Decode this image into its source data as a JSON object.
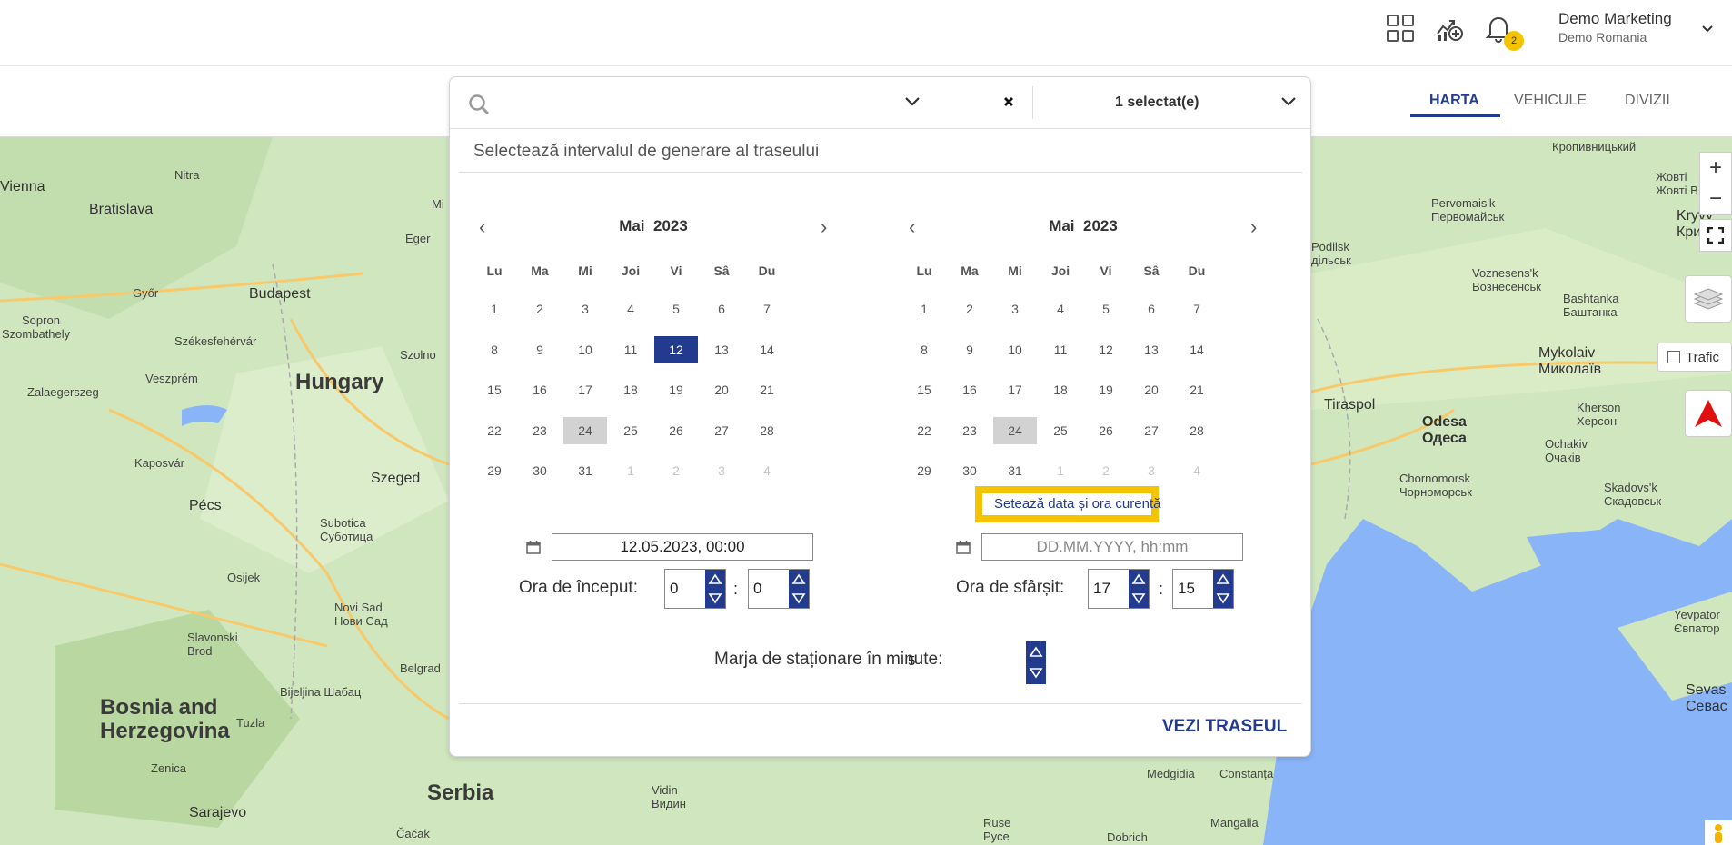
{
  "header": {
    "apps_icon": "grid-icon",
    "stats_icon": "chart-add-icon",
    "bell_icon": "bell-icon",
    "notification_count": "2",
    "user_name": "Demo Marketing",
    "user_org": "Demo Romania"
  },
  "nav": {
    "tabs": [
      "HARTA",
      "VEHICULE",
      "DIVIZII"
    ],
    "active": "HARTA"
  },
  "panel": {
    "search_placeholder": "",
    "selected_label": "1 selectat(e)",
    "title": "Selectează intervalul de generare al traseului",
    "left_calendar": {
      "month": "Mai",
      "year": "2023",
      "selected_day": 12,
      "today": 24
    },
    "right_calendar": {
      "month": "Mai",
      "year": "2023",
      "today": 24
    },
    "weekdays": [
      "Lu",
      "Ma",
      "Mi",
      "Joi",
      "Vi",
      "Sâ",
      "Du"
    ],
    "weeks": [
      [
        "1",
        "2",
        "3",
        "4",
        "5",
        "6",
        "7"
      ],
      [
        "8",
        "9",
        "10",
        "11",
        "12",
        "13",
        "14"
      ],
      [
        "15",
        "16",
        "17",
        "18",
        "19",
        "20",
        "21"
      ],
      [
        "22",
        "23",
        "24",
        "25",
        "26",
        "27",
        "28"
      ],
      [
        "29",
        "30",
        "31",
        "1",
        "2",
        "3",
        "4"
      ]
    ],
    "set_now_button": "Setează data și ora curentă",
    "start_date_value": "12.05.2023, 00:00",
    "end_date_placeholder": "DD.MM.YYYY, hh:mm",
    "start_time_label": "Ora de început:",
    "start_hour": "0",
    "start_minute": "0",
    "end_time_label": "Ora de sfârșit:",
    "end_hour": "17",
    "end_minute": "15",
    "colon": ":",
    "margin_label": "Marja de staționare în minute:",
    "margin_value": "5",
    "submit": "VEZI TRASEUL"
  },
  "map": {
    "traffic_label": "Trafic",
    "zoom_in": "+",
    "zoom_out": "−",
    "labels": {
      "vienna": "Vienna",
      "bratislava": "Bratislava",
      "nitra": "Nitra",
      "gyor": "Győr",
      "budapest": "Budapest",
      "sopron": "Sopron",
      "szombathely": "Szombathely",
      "szekesfehervar": "Székesfehérvár",
      "szolno": "Szolno",
      "hungary": "Hungary",
      "veszprem": "Veszprém",
      "zalaegerszeg": "Zalaegerszeg",
      "kaposvar": "Kaposvár",
      "pecs": "Pécs",
      "szeged": "Szeged",
      "subotica": "Subotica\nСуботица",
      "osijek": "Osijek",
      "novi_sad": "Novi Sad\nНови Сад",
      "slavonski": "Slavonski\nBrod",
      "belgrad": "Belgrad",
      "bijeljina": "Bijeljina Шабац",
      "bosnia": "Bosnia and\nHerzegovina",
      "tuzla": "Tuzla",
      "zenica": "Zenica",
      "serbia": "Serbia",
      "sarajevo": "Sarajevo",
      "cacak": "Čačak",
      "egger": "Eger",
      "vidin": "Vidin\nВидин",
      "ruse": "Ruse\nРусе",
      "dobrich": "Dobrich",
      "medgidia": "Medgidia",
      "constanta": "Constanța",
      "mangalia": "Mangalia",
      "pervomaisk": "Pervomais'k\nПервомайськ",
      "podilsk": "Podilsk\nдільськ",
      "voznesensk": "Voznesens'k\nВознесенськ",
      "bashtanka": "Bashtanka\nБаштанка",
      "mykolaiv": "Mykolaiv\nМиколаїв",
      "tiraspol": "Tiraspol",
      "odesa": "Odesa\nОдеса",
      "kherson": "Kherson\nХерсон",
      "ochakiv": "Ochakiv\nОчаків",
      "chornomorsk": "Chornomorsk\nЧорноморськ",
      "skadovsk": "Skadovs'k\nСкадовськ",
      "kropyv": "Кропивницький",
      "zhovti": "Жовті\nЖовті В",
      "kryvyi": "Kryvy\nКрив",
      "yevpator": "Yevpator\nЄвпатор",
      "sevast": "Sevas\nСевас",
      "milo": "Mi"
    }
  }
}
